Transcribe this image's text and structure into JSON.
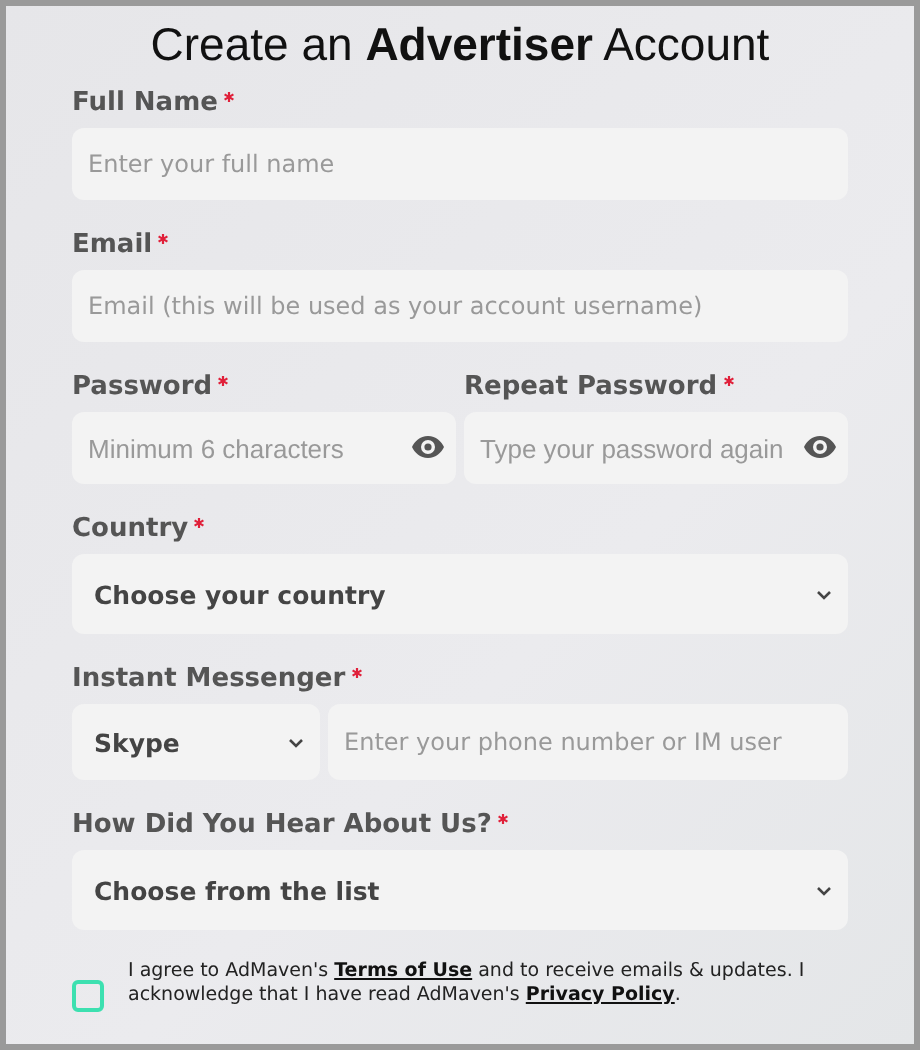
{
  "title": "Create an **Advertiser** Account",
  "fields": [
    {
      "kind": "text",
      "label": "Full Name",
      "required": true,
      "placeholder": "Enter your full name"
    },
    {
      "kind": "text",
      "label": "Email",
      "required": true,
      "placeholder": "Email (this will be used as your account username)"
    },
    {
      "kind": "password-pair",
      "items": [
        {
          "label": "Password",
          "required": true,
          "placeholder": "Minimum 6 characters"
        },
        {
          "label": "Repeat Password",
          "required": true,
          "placeholder": "Type your password again"
        }
      ]
    },
    {
      "kind": "select",
      "label": "Country",
      "required": true,
      "value": "Choose your country"
    },
    {
      "kind": "messenger",
      "label": "Instant Messenger",
      "required": true,
      "value": "Skype",
      "placeholder": "Enter your phone number or IM user"
    },
    {
      "kind": "select",
      "label": "How Did You Hear About Us?",
      "required": true,
      "value": "Choose from the list"
    }
  ],
  "consent": {
    "checked": false,
    "text_before": "I agree to AdMaven's ",
    "terms_link": "Terms of Use",
    "text_middle": " and to receive emails & updates. I acknowledge that I have read AdMaven's ",
    "privacy_link": "Privacy Policy",
    "text_after": "."
  }
}
